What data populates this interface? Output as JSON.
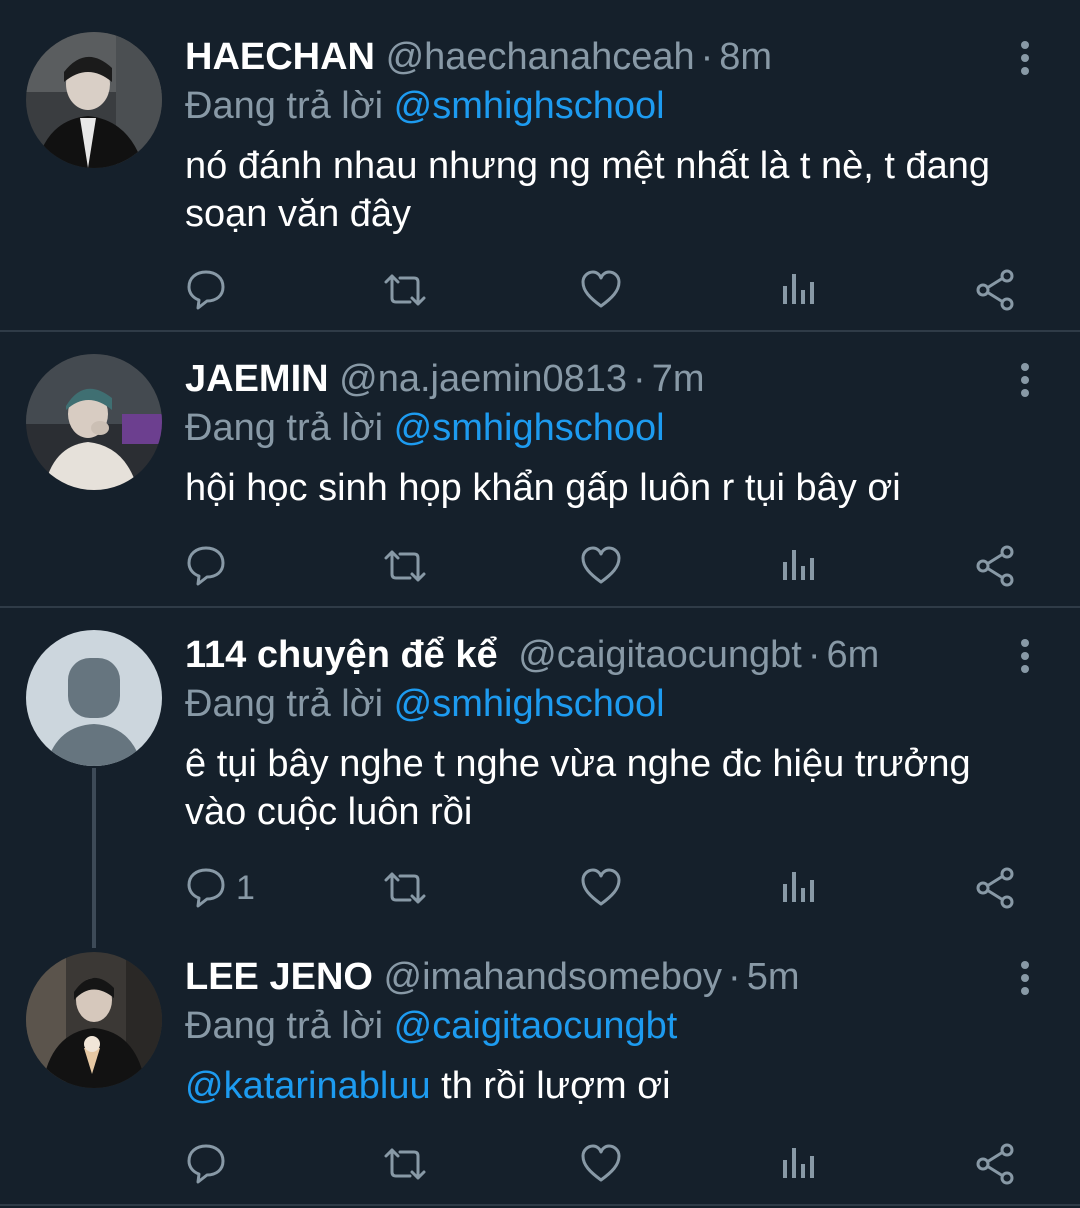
{
  "tweets": [
    {
      "name": "HAECHAN",
      "handle": "@haechanahceah",
      "separator": "·",
      "time": "8m",
      "replying_prefix": "Đang trả lời",
      "replying_to": "@smhighschool",
      "text_line1": "nó đánh nhau nhưng ng mệt nhất là t nè, t đang",
      "text_line2": "soạn văn đây",
      "reply_count": ""
    },
    {
      "name": "JAEMIN",
      "handle": "@na.jaemin0813",
      "separator": "·",
      "time": "7m",
      "replying_prefix": "Đang trả lời",
      "replying_to": "@smhighschool",
      "text_line1": "hội học sinh họp khẩn gấp luôn r tụi bây ơi",
      "reply_count": ""
    },
    {
      "name": "114 chuyện để kể",
      "handle": "@caigitaocungbt",
      "separator": "·",
      "time": "6m",
      "replying_prefix": "Đang trả lời",
      "replying_to": "@smhighschool",
      "text_line1": "ê tụi bây nghe t nghe vừa nghe đc hiệu trưởng",
      "text_line2": "vào cuộc luôn rồi",
      "reply_count": "1"
    },
    {
      "name": "LEE JENO",
      "handle": "@imahandsomeboy",
      "separator": "·",
      "time": "5m",
      "replying_prefix": "Đang trả lời",
      "replying_to": "@caigitaocungbt",
      "mention": "@katarinabluu",
      "text_rest": " th rồi lượm ơi",
      "reply_count": ""
    }
  ],
  "icons": [
    "more-vertical-icon",
    "reply-icon",
    "retweet-icon",
    "like-icon",
    "analytics-icon",
    "share-icon"
  ],
  "colors": {
    "background": "#15202b",
    "secondary_text": "#8899a6",
    "link": "#1d9bf0",
    "divider": "#2f3b47"
  }
}
